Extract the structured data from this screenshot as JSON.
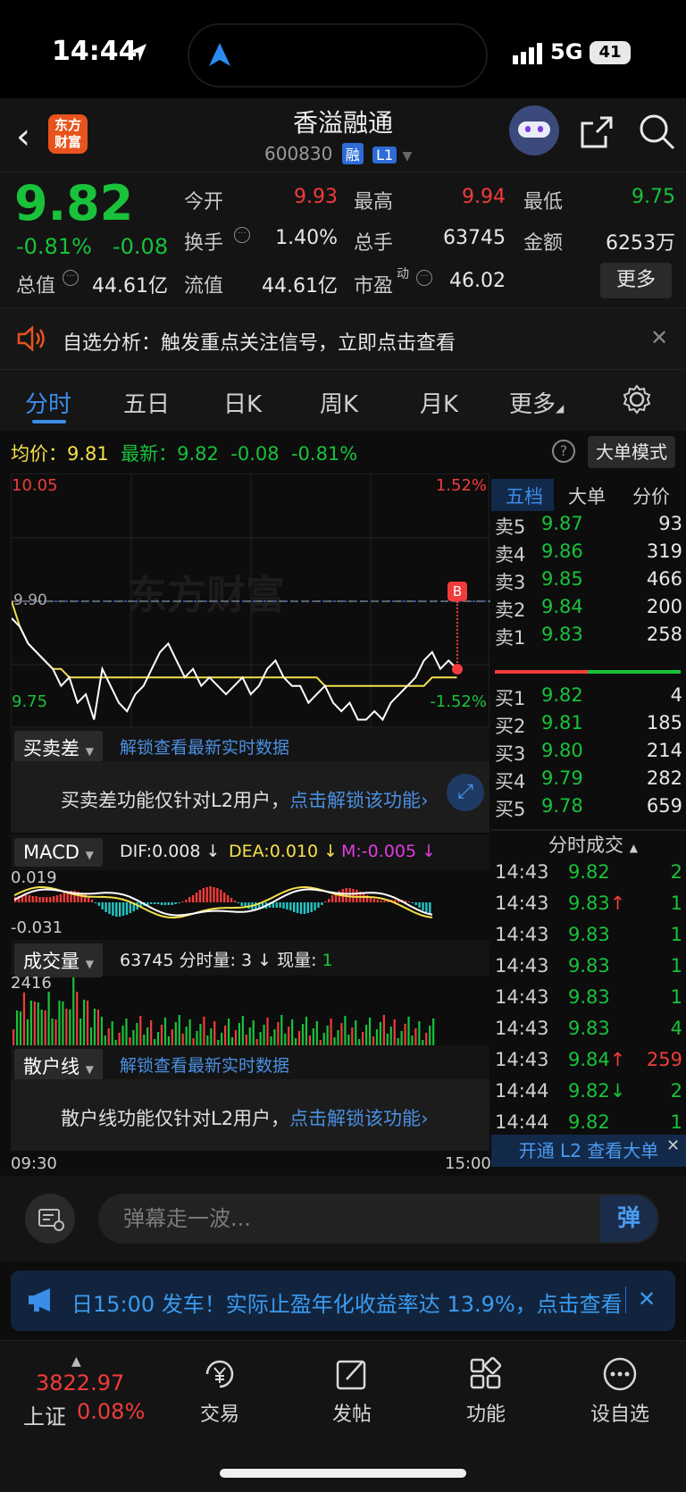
{
  "status": {
    "time": "14:44",
    "network": "5G",
    "battery": "41"
  },
  "header": {
    "title": "香溢融通",
    "code": "600830",
    "tag_margin": "融",
    "tag_level": "L1",
    "logo_text_1": "东方",
    "logo_text_2": "财富"
  },
  "quote": {
    "price": "9.82",
    "change_pct": "-0.81%",
    "change": "-0.08",
    "open_label": "今开",
    "open": "9.93",
    "high_label": "最高",
    "high": "9.94",
    "low_label": "最低",
    "low": "9.75",
    "turnover_label": "换手",
    "turnover": "1.40%",
    "volume_label": "总手",
    "volume": "63745",
    "amount_label": "金额",
    "amount": "6253万",
    "mktcap_label": "总值",
    "mktcap": "44.61亿",
    "float_label": "流值",
    "float": "44.61亿",
    "pe_label": "市盈",
    "pe_sup": "动",
    "pe": "46.02",
    "more": "更多"
  },
  "banner": {
    "text": "自选分析：触发重点关注信号，立即点击查看"
  },
  "tabs": [
    "分时",
    "五日",
    "日K",
    "周K",
    "月K",
    "更多"
  ],
  "info": {
    "avg_label": "均价：",
    "avg": "9.81",
    "latest_label": "最新：",
    "latest": "9.82",
    "chg": "-0.08",
    "pct": "-0.81%",
    "mode_button": "大单模式"
  },
  "chart_data": {
    "type": "line",
    "y_top": "10.05",
    "y_top_pct": "1.52%",
    "y_bottom": "9.75",
    "y_bottom_pct": "-1.52%",
    "ref_line": "9.90",
    "marker": "B",
    "x_start": "09:30",
    "x_end": "15:00",
    "price": [
      9.88,
      9.87,
      9.85,
      9.84,
      9.83,
      9.82,
      9.8,
      9.81,
      9.78,
      9.79,
      9.76,
      9.82,
      9.8,
      9.78,
      9.77,
      9.79,
      9.8,
      9.82,
      9.84,
      9.85,
      9.83,
      9.81,
      9.82,
      9.8,
      9.81,
      9.8,
      9.79,
      9.8,
      9.81,
      9.79,
      9.8,
      9.82,
      9.83,
      9.81,
      9.8,
      9.8,
      9.78,
      9.79,
      9.8,
      9.78,
      9.77,
      9.78,
      9.76,
      9.76,
      9.77,
      9.76,
      9.78,
      9.79,
      9.8,
      9.81,
      9.83,
      9.84,
      9.82,
      9.83,
      9.82
    ],
    "avg": [
      9.9,
      9.87,
      9.85,
      9.84,
      9.83,
      9.82,
      9.82,
      9.81,
      9.81,
      9.81,
      9.81,
      9.81,
      9.81,
      9.81,
      9.81,
      9.81,
      9.81,
      9.81,
      9.81,
      9.81,
      9.81,
      9.81,
      9.81,
      9.81,
      9.81,
      9.81,
      9.81,
      9.81,
      9.81,
      9.81,
      9.81,
      9.81,
      9.81,
      9.81,
      9.81,
      9.81,
      9.81,
      9.81,
      9.8,
      9.8,
      9.8,
      9.8,
      9.8,
      9.8,
      9.8,
      9.8,
      9.8,
      9.8,
      9.8,
      9.8,
      9.8,
      9.81,
      9.81,
      9.81,
      9.81
    ]
  },
  "spread_panel": {
    "label": "买卖差",
    "unlock": "解锁查看最新实时数据",
    "notice": "买卖差功能仅针对L2用户，",
    "notice_link": "点击解锁该功能"
  },
  "macd": {
    "label": "MACD",
    "dif": "DIF:0.008 ↓",
    "dea": "DEA:0.010 ↓",
    "m": "M:-0.005 ↓",
    "top": "0.019",
    "bottom": "-0.031"
  },
  "volume_panel": {
    "label": "成交量",
    "total": "63745",
    "minute_label": "分时量:",
    "minute": "3 ↓",
    "now_label": "现量:",
    "now": "1",
    "max": "2416"
  },
  "retail_panel": {
    "label": "散户线",
    "unlock": "解锁查看最新实时数据",
    "notice": "散户线功能仅针对L2用户，",
    "notice_link": "点击解锁该功能"
  },
  "order_book": {
    "tabs": [
      "五档",
      "大单",
      "分价"
    ],
    "asks": [
      {
        "label": "卖5",
        "price": "9.87",
        "vol": "93"
      },
      {
        "label": "卖4",
        "price": "9.86",
        "vol": "319"
      },
      {
        "label": "卖3",
        "price": "9.85",
        "vol": "466"
      },
      {
        "label": "卖2",
        "price": "9.84",
        "vol": "200"
      },
      {
        "label": "卖1",
        "price": "9.83",
        "vol": "258"
      }
    ],
    "bids": [
      {
        "label": "买1",
        "price": "9.82",
        "vol": "4"
      },
      {
        "label": "买2",
        "price": "9.81",
        "vol": "185"
      },
      {
        "label": "买3",
        "price": "9.80",
        "vol": "214"
      },
      {
        "label": "买4",
        "price": "9.79",
        "vol": "282"
      },
      {
        "label": "买5",
        "price": "9.78",
        "vol": "659"
      }
    ]
  },
  "trades": {
    "title": "分时成交",
    "rows": [
      {
        "time": "14:43",
        "price": "9.82",
        "vol": "2"
      },
      {
        "time": "14:43",
        "price": "9.83↑",
        "vol": "1"
      },
      {
        "time": "14:43",
        "price": "9.83",
        "vol": "1"
      },
      {
        "time": "14:43",
        "price": "9.83",
        "vol": "1"
      },
      {
        "time": "14:43",
        "price": "9.83",
        "vol": "1"
      },
      {
        "time": "14:43",
        "price": "9.83",
        "vol": "4"
      },
      {
        "time": "14:43",
        "price": "9.84↑",
        "vol": "259"
      },
      {
        "time": "14:44",
        "price": "9.82↓",
        "vol": "2"
      },
      {
        "time": "14:44",
        "price": "9.82",
        "vol": "1"
      }
    ],
    "l2_bar": "开通 L2 查看大单"
  },
  "danmu": {
    "placeholder": "弹幕走一波...",
    "button": "弹"
  },
  "ad": {
    "text": "日15:00 发车！实际止盈年化收益率达 13.9%，点击查看"
  },
  "nav": {
    "index_value": "3822.97",
    "index_name": "上证",
    "index_pct": "0.08%",
    "items": [
      "交易",
      "发帖",
      "功能",
      "设自选"
    ]
  }
}
